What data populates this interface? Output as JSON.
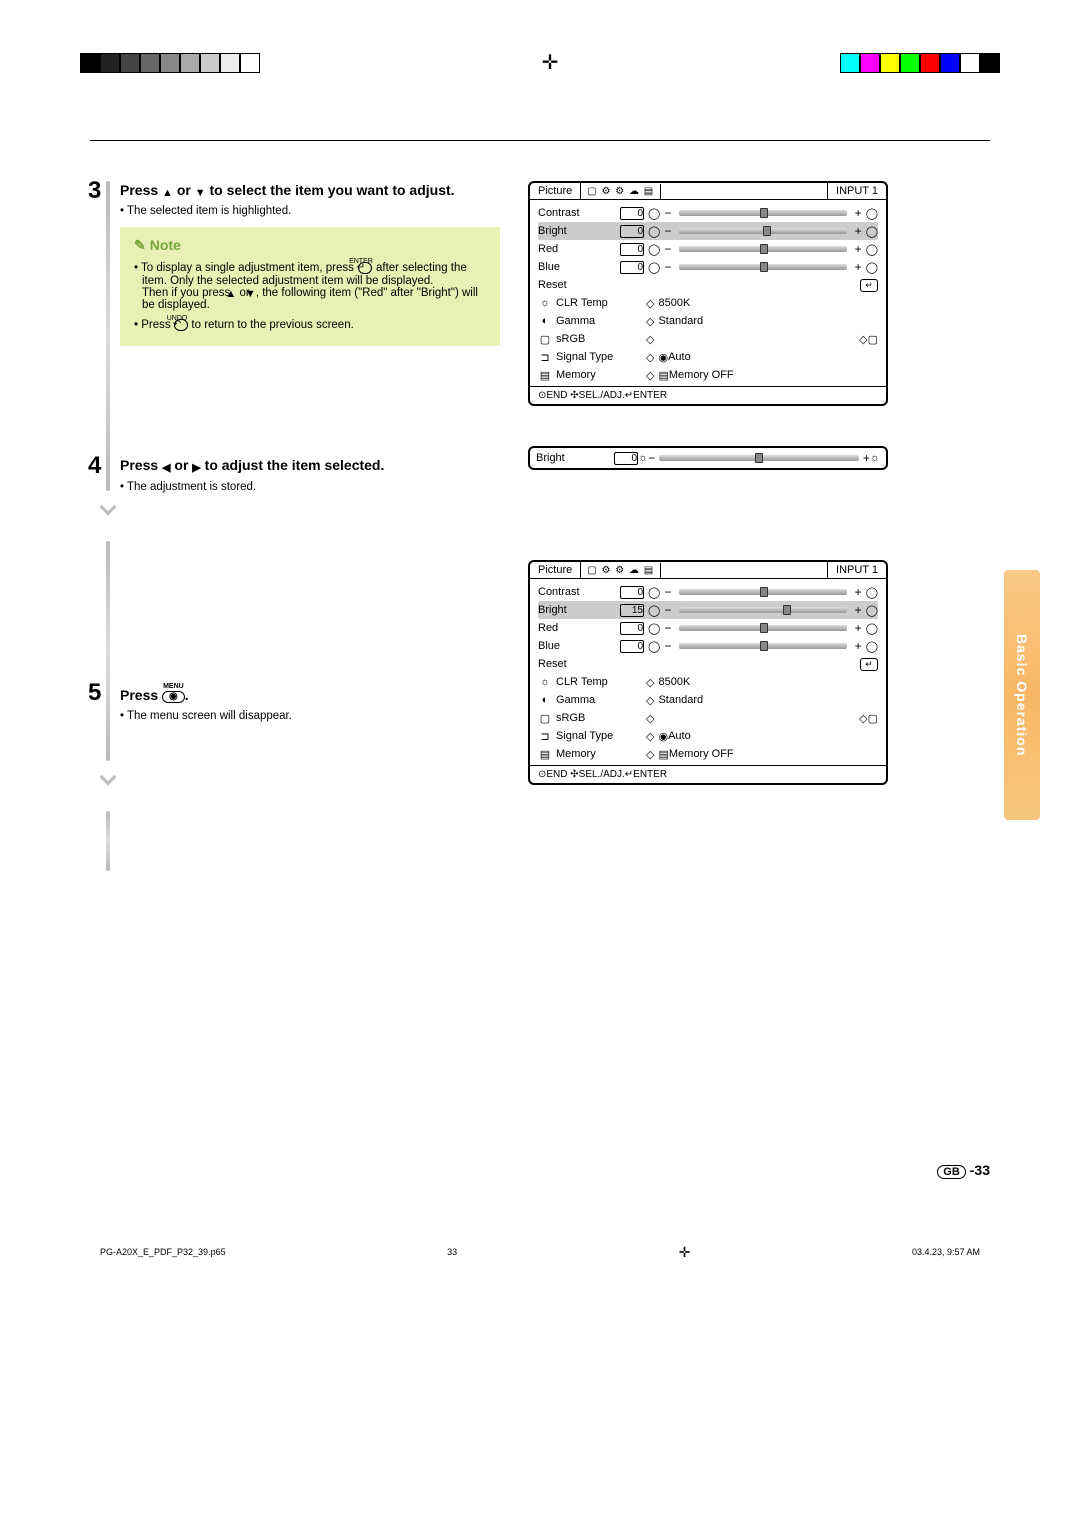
{
  "side_tab": "Basic Operation",
  "page_number": "-33",
  "gb_badge": "GB",
  "footer": {
    "file": "PG-A20X_E_PDF_P32_39.p65",
    "page": "33",
    "datetime": "03.4.23, 9:57 AM"
  },
  "steps": {
    "s3": {
      "num": "3",
      "title_a": "Press ",
      "title_b": " or ",
      "title_c": " to select the item you want to adjust.",
      "detail": "• The selected item is highlighted."
    },
    "s4": {
      "num": "4",
      "title_a": "Press ",
      "title_b": " or ",
      "title_c": " to adjust the item selected.",
      "detail": "• The adjustment is stored."
    },
    "s5": {
      "num": "5",
      "title_a": "Press ",
      "key_label": "MENU",
      "title_b": ".",
      "detail": "• The menu screen will disappear."
    }
  },
  "note": {
    "header": "Note",
    "item1_a": "To display a single adjustment item, press ",
    "enter_label": "ENTER",
    "item1_b": " after selecting the item. Only the selected adjustment item will be displayed.",
    "item1_c": "Then if you press ",
    "item1_d": " or ",
    "item1_e": ", the following item (\"Red\" after \"Bright\") will be displayed.",
    "item2_a": "Press ",
    "undo_label": "UNDO",
    "item2_b": " to return to the previous screen."
  },
  "osd_common": {
    "tab": "Picture",
    "input": "INPUT 1",
    "footer": "⊙END ✣SEL./ADJ.↵ENTER",
    "rows": [
      "Contrast",
      "Bright",
      "Red",
      "Blue",
      "Reset"
    ],
    "settings": [
      {
        "icon": "☼",
        "label": "CLR Temp",
        "value": "8500K"
      },
      {
        "icon": "◐",
        "label": "Gamma",
        "value": "Standard"
      },
      {
        "icon": "▢",
        "label": "sRGB",
        "value": "",
        "toggle": true
      },
      {
        "icon": "⊐",
        "label": "Signal Type",
        "value": "Auto"
      },
      {
        "icon": "▤",
        "label": "Memory",
        "value": "Memory OFF"
      }
    ]
  },
  "osd_values": {
    "screen1": {
      "Contrast": "0",
      "Bright": "0",
      "Red": "0",
      "Blue": "0",
      "highlight": "Bright",
      "knob_pct": 50
    },
    "screen2": {
      "Contrast": "0",
      "Bright": "15",
      "Red": "0",
      "Blue": "0",
      "highlight": "Bright",
      "knob_pct": 62
    }
  },
  "mini": {
    "label": "Bright",
    "value": "0"
  }
}
